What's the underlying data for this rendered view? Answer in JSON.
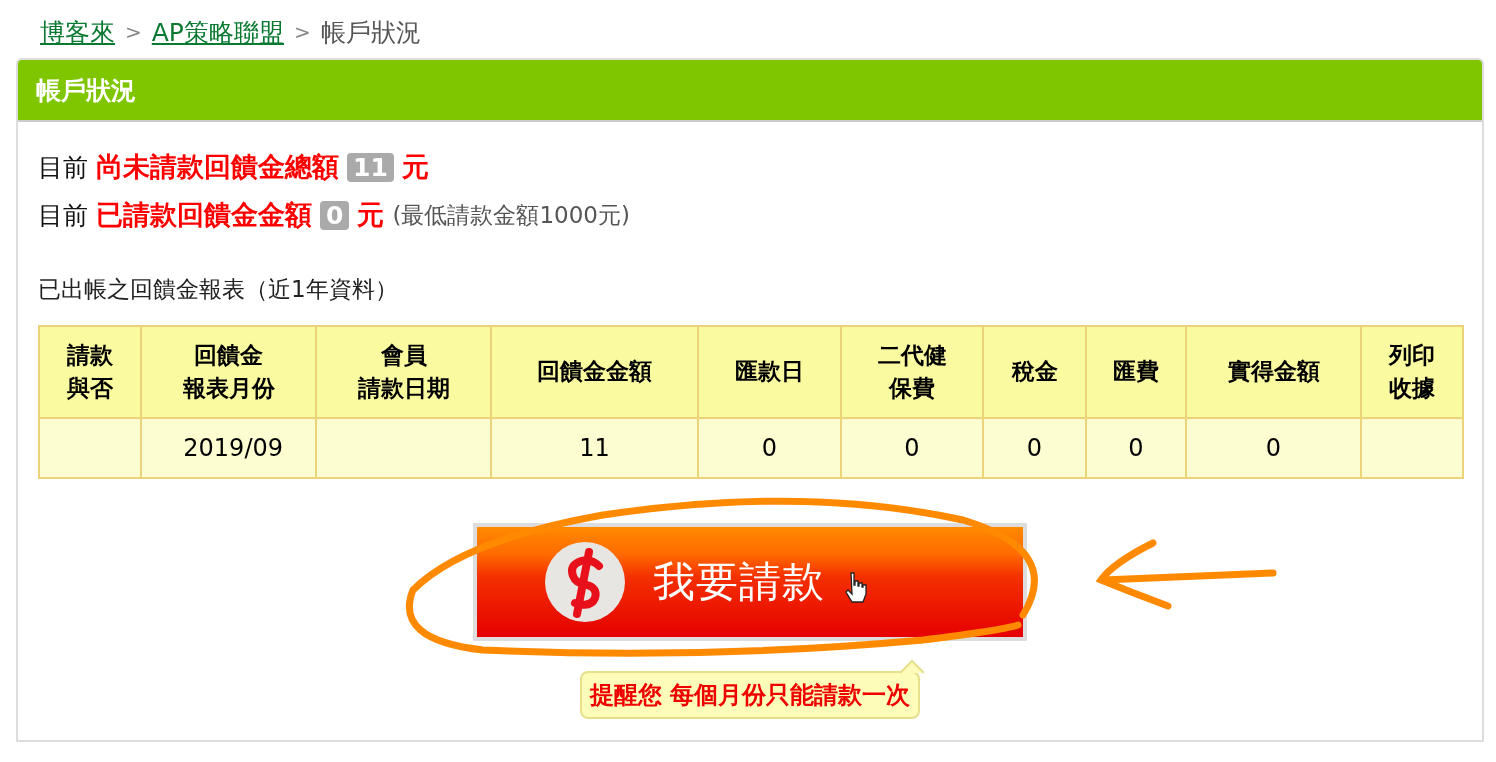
{
  "breadcrumb": [
    {
      "label": "博客來",
      "kind": "link"
    },
    {
      "label": "AP策略聯盟",
      "kind": "link"
    },
    {
      "label": "帳戶狀況",
      "kind": "current"
    }
  ],
  "breadcrumb_separator": ">",
  "panel": {
    "title": "帳戶狀況"
  },
  "totals": [
    {
      "prefix": "目前",
      "label": "尚未請款回饋金總額",
      "amount": "11",
      "unit": "元"
    },
    {
      "prefix": "目前",
      "label": "已請款回饋金金額",
      "amount": "0",
      "unit": "元",
      "note": "(最低請款金額1000元)"
    }
  ],
  "report_caption": "已出帳之回饋金報表（近1年資料）",
  "table": {
    "columns": [
      "請款與否",
      "回饋金報表月份",
      "會員請款日期",
      "回饋金金額",
      "匯款日",
      "二代健保費",
      "稅金",
      "匯費",
      "實得金額",
      "列印收據"
    ],
    "rows": [
      [
        null,
        "2019/09",
        null,
        "11",
        "0",
        "0",
        "0",
        "0",
        "0",
        null
      ]
    ]
  },
  "request_button": {
    "label": "我要請款"
  },
  "tooltip": "提醒您 每個月份只能請款一次"
}
